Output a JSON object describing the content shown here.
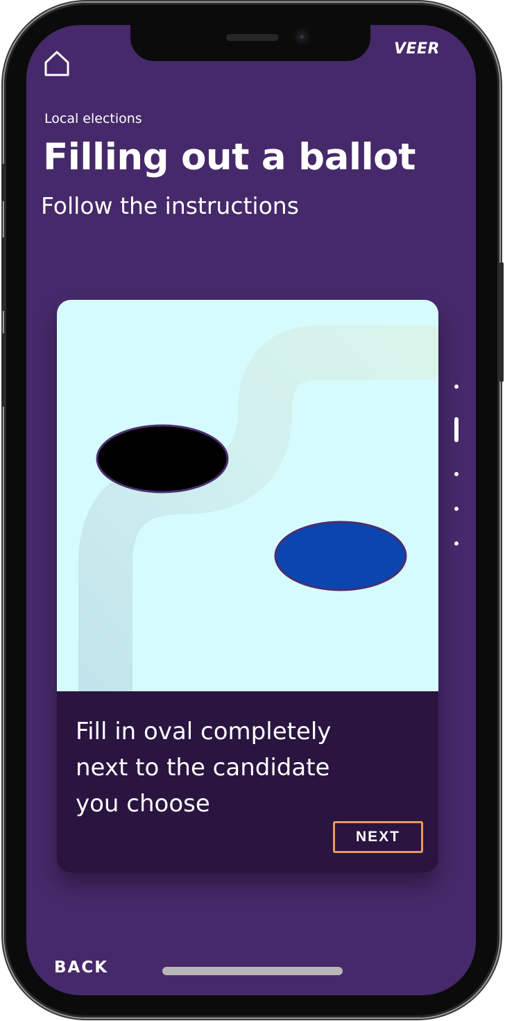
{
  "header": {
    "brand": "VEER",
    "home_icon": "home-icon"
  },
  "page": {
    "kicker": "Local elections",
    "title": "Filling out a ballot",
    "subtitle": "Follow the instructions"
  },
  "card": {
    "instruction": "Fill in oval completely next to the candidate you choose",
    "next_label": "NEXT",
    "ovals": [
      {
        "name": "filled-oval",
        "color": "#000000"
      },
      {
        "name": "blue-oval",
        "color": "#0a45b0"
      }
    ]
  },
  "pager": {
    "count": 5,
    "active_index": 1
  },
  "footer": {
    "back_label": "BACK"
  },
  "colors": {
    "background": "#46296a",
    "card_bottom": "#2a1440",
    "illustration_bg": "#d6fbfd",
    "accent_border": "#e89a63"
  }
}
